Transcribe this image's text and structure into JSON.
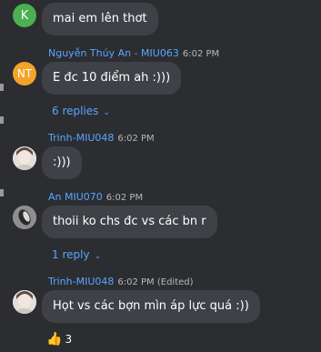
{
  "messages": [
    {
      "avatar_text": "K",
      "text": "mai em lên thơt"
    },
    {
      "sender": "Nguyễn Thúy An - MIU063",
      "time": "6:02 PM",
      "avatar_text": "NT",
      "text": "E đc 10 điểm ah :)))",
      "replies": "6 replies"
    },
    {
      "sender": "Trinh-MIU048",
      "time": "6:02 PM",
      "text": ":)))"
    },
    {
      "sender": "An MIU070",
      "time": "6:02 PM",
      "text": "thoii ko chs đc vs các bn r",
      "replies": "1 reply"
    },
    {
      "sender": "Trinh-MIU048",
      "time": "6:02 PM (Edited)",
      "text": "Họt vs các bợn mìn áp lực quá :))",
      "reaction_count": "3"
    }
  ],
  "icons": {
    "chevron": "chevron-down-icon",
    "reaction": "thumbs-up-icon"
  },
  "colors": {
    "background": "#2b2d31",
    "bubble": "#3f4147",
    "link": "#58a6ff",
    "avatar_k": "#4caf50",
    "avatar_nt": "#f4a32a"
  }
}
